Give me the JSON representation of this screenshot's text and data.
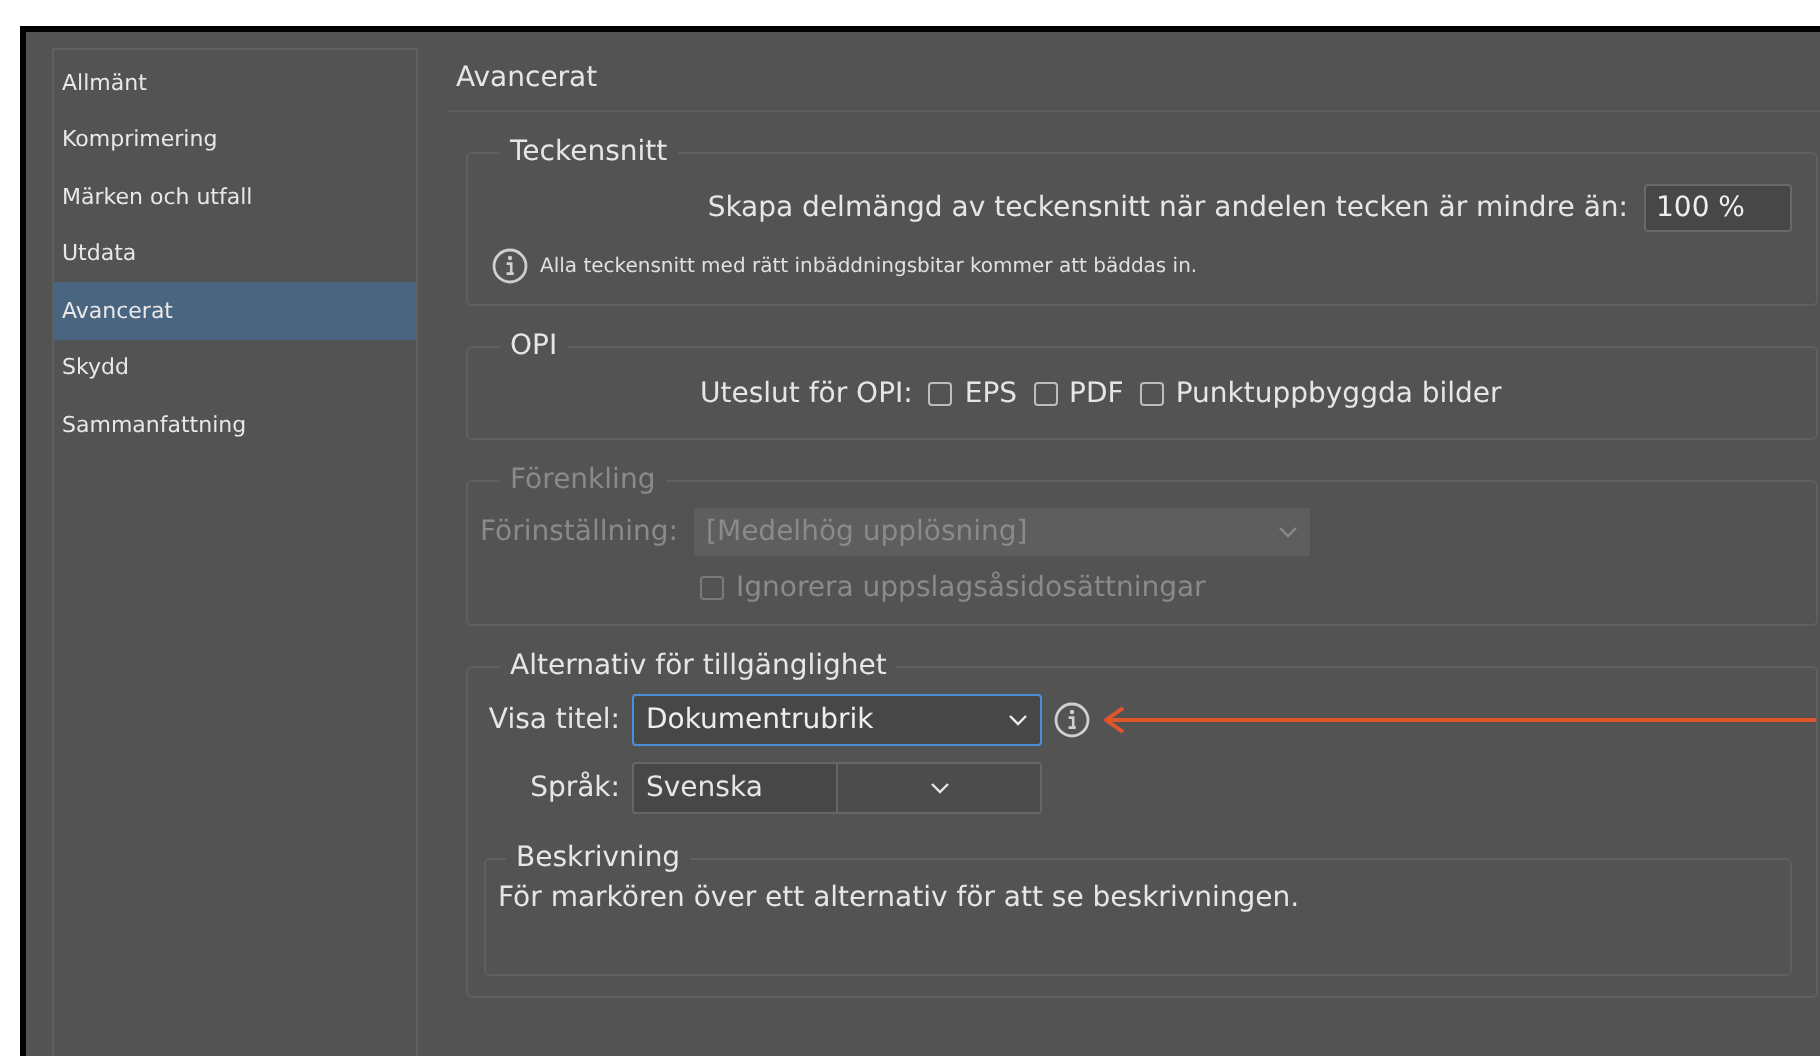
{
  "sidebar": {
    "items": [
      {
        "label": "Allmänt",
        "selected": false
      },
      {
        "label": "Komprimering",
        "selected": false
      },
      {
        "label": "Märken och utfall",
        "selected": false
      },
      {
        "label": "Utdata",
        "selected": false
      },
      {
        "label": "Avancerat",
        "selected": true
      },
      {
        "label": "Skydd",
        "selected": false
      },
      {
        "label": "Sammanfattning",
        "selected": false
      }
    ]
  },
  "page_title": "Avancerat",
  "fonts": {
    "legend": "Teckensnitt",
    "subset_label": "Skapa delmängd av teckensnitt när andelen tecken är mindre än:",
    "subset_value": "100 %",
    "info": "Alla teckensnitt med rätt inbäddningsbitar kommer att bäddas in."
  },
  "opi": {
    "legend": "OPI",
    "label": "Uteslut för OPI:",
    "options": [
      {
        "label": "EPS",
        "checked": false
      },
      {
        "label": "PDF",
        "checked": false
      },
      {
        "label": "Punktuppbyggda bilder",
        "checked": false
      }
    ]
  },
  "flattening": {
    "legend": "Förenkling",
    "disabled": true,
    "preset_label": "Förinställning:",
    "preset_value": "[Medelhög upplösning]",
    "ignore": {
      "label": "Ignorera uppslagsåsidosättningar",
      "checked": false
    }
  },
  "accessibility": {
    "legend": "Alternativ för tillgänglighet",
    "display_title": {
      "label": "Visa titel:",
      "value": "Dokumentrubrik",
      "focused": true
    },
    "language": {
      "label": "Språk:",
      "value": "Svenska",
      "focused": false
    }
  },
  "description": {
    "legend": "Beskrivning",
    "text": "För markören över ett alternativ för att se beskrivningen."
  }
}
